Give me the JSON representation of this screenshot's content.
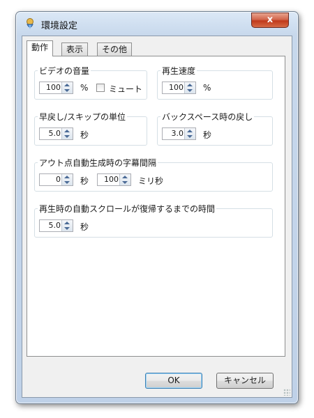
{
  "window": {
    "title": "環境設定",
    "close_glyph": "x"
  },
  "tabs": [
    {
      "label": "動作",
      "active": true
    },
    {
      "label": "表示",
      "active": false
    },
    {
      "label": "その他",
      "active": false
    }
  ],
  "video_volume": {
    "title": "ビデオの音量",
    "value": "100",
    "unit": "%",
    "mute_label": "ミュート",
    "mute_checked": false
  },
  "playback_speed": {
    "title": "再生速度",
    "value": "100",
    "unit": "%"
  },
  "rewind_skip": {
    "title": "早戻し/スキップの単位",
    "value": "5.0",
    "unit": "秒"
  },
  "backspace_rewind": {
    "title": "バックスペース時の戻し",
    "value": "3.0",
    "unit": "秒"
  },
  "out_point_gap": {
    "title": "アウト点自動生成時の字幕間隔",
    "seconds_value": "0",
    "seconds_unit": "秒",
    "ms_value": "100",
    "ms_unit": "ミリ秒"
  },
  "auto_scroll": {
    "title": "再生時の自動スクロールが復帰するまでの時間",
    "value": "5.0",
    "unit": "秒"
  },
  "buttons": {
    "ok": "OK",
    "cancel": "キャンセル"
  }
}
